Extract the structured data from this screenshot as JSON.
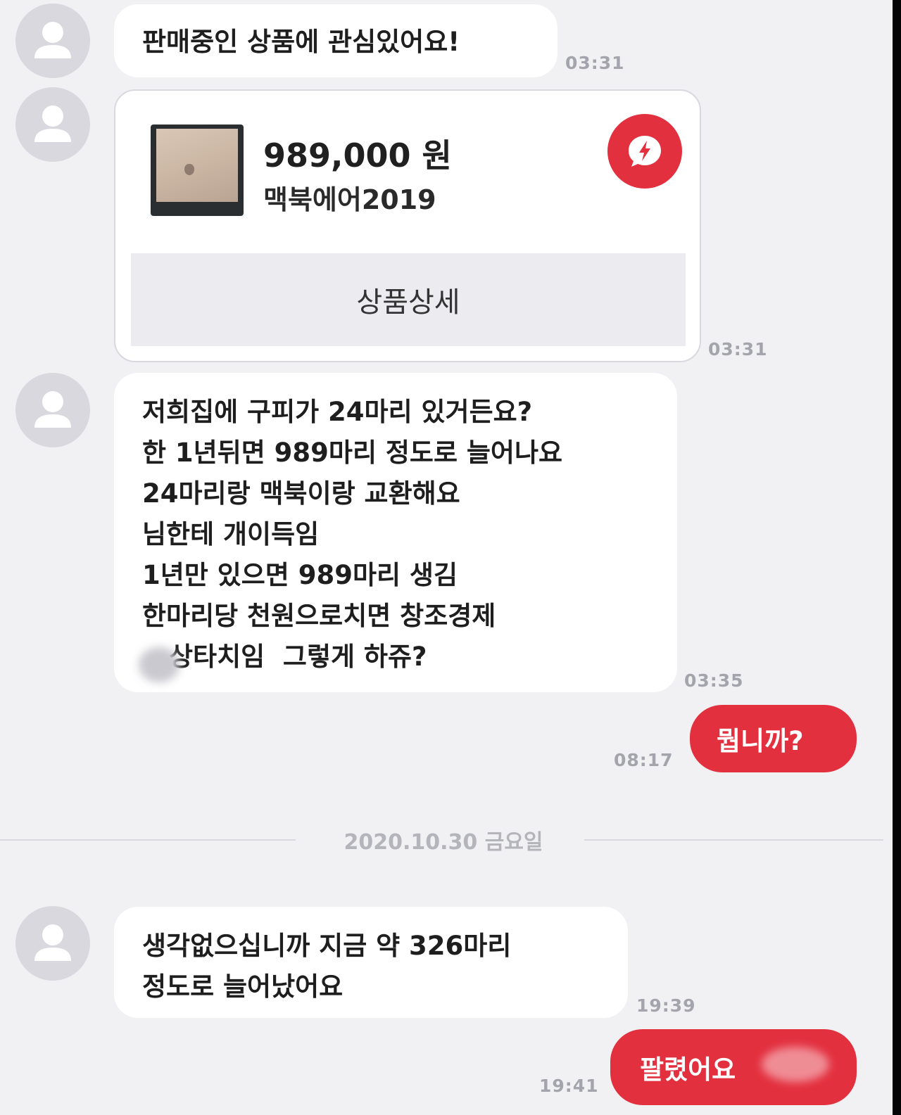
{
  "messages": {
    "m1": {
      "text": "판매중인 상품에 관심있어요!",
      "time": "03:31"
    },
    "product_card": {
      "price": "989,000 원",
      "name": "맥북에어2019",
      "detail_label": "상품상세",
      "time": "03:31"
    },
    "m3": {
      "lines": [
        "저희집에 구피가 24마리 있거든요?",
        "한 1년뒤면 989마리 정도로 늘어나요",
        "24마리랑 맥북이랑 교환해요",
        "님한테 개이득임",
        "1년만 있으면 989마리 생김",
        "한마리당 천원으로치면 창조경제",
        "상타치임  그렇게 하쥬?"
      ],
      "time": "03:35"
    },
    "s1": {
      "text": "뭡니까?",
      "time": "08:17"
    },
    "date_separator": "2020.10.30 금요일",
    "m4": {
      "lines": [
        "생각없으십니까 지금 약 326마리",
        "정도로 늘어났어요"
      ],
      "time": "19:39"
    },
    "s2": {
      "text": "팔렸어요",
      "time": "19:41"
    }
  },
  "icons": {
    "avatar": "person-icon",
    "product_badge": "lightning-chat-icon"
  },
  "colors": {
    "background": "#f1f1f4",
    "received_bubble": "#ffffff",
    "sent_bubble": "#e3303f",
    "timestamp": "#a4a4ac"
  }
}
